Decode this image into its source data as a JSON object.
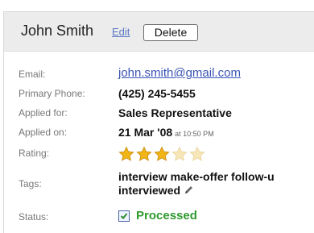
{
  "candidate": {
    "name": "John Smith",
    "edit_label": "Edit",
    "delete_label": "Delete"
  },
  "labels": {
    "email": "Email:",
    "phone": "Primary Phone:",
    "applied_for": "Applied for:",
    "applied_on": "Applied on:",
    "rating": "Rating:",
    "tags": "Tags:",
    "status": "Status:"
  },
  "values": {
    "email": "john.smith@gmail.com",
    "phone": "(425) 245-5455",
    "applied_for": "Sales Representative",
    "applied_on_date": "21 Mar '08",
    "applied_on_time": "at 10:50 PM",
    "rating": 3,
    "rating_max": 5,
    "tags": [
      "interview",
      "make-offer",
      "follow-u",
      "interviewed"
    ],
    "tags_line1": "interview make-offer follow-u",
    "tags_line2": "interviewed",
    "status": "Processed",
    "status_checked": true
  },
  "colors": {
    "star_filled": "#f2b518",
    "star_empty": "#f7e7b8",
    "status_green": "#2e9a2e",
    "link_blue": "#3a54b4"
  },
  "icons": {
    "edit_tags": "pencil-icon",
    "status": "checkbox-icon",
    "rating": "star-icon"
  }
}
